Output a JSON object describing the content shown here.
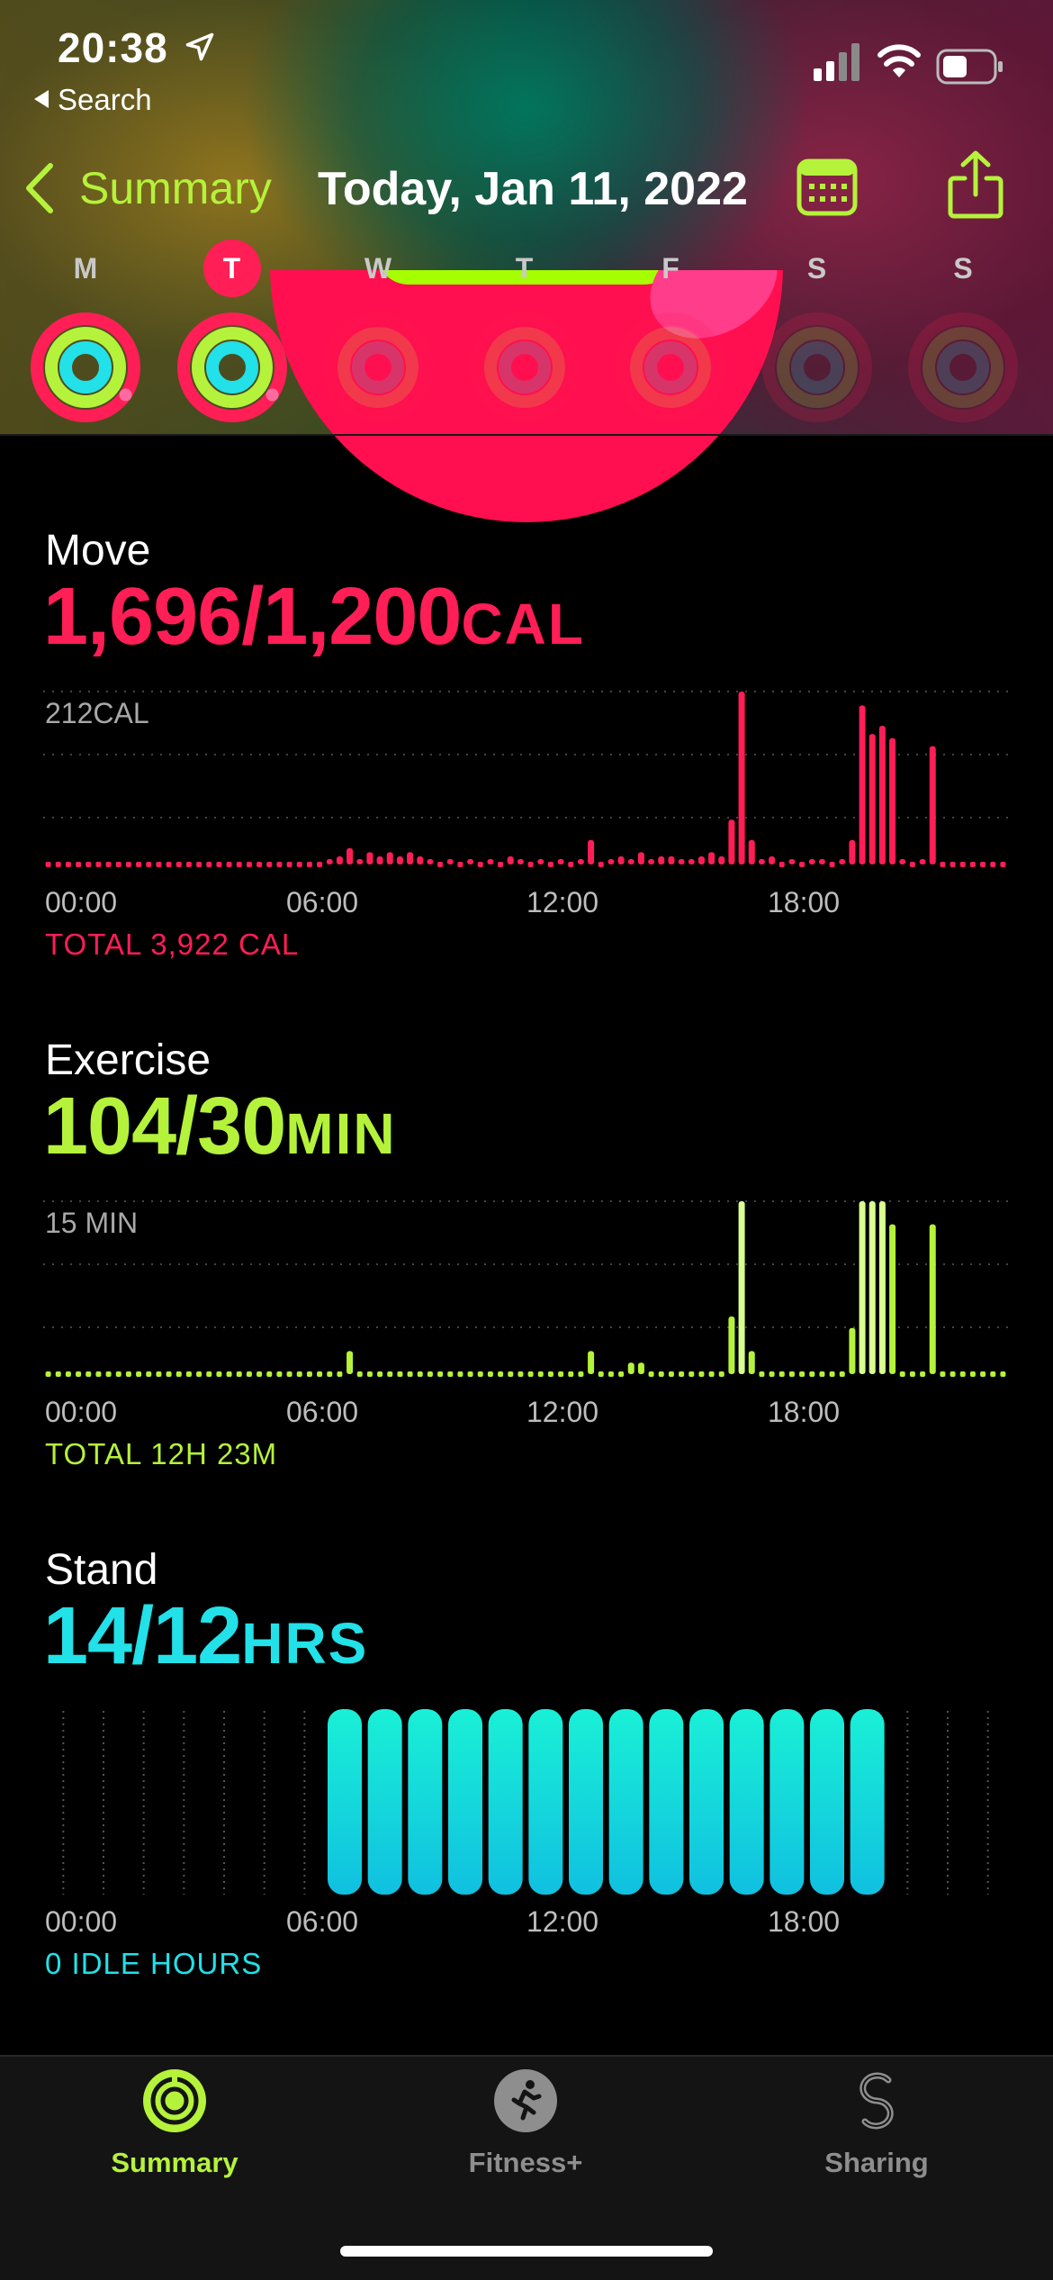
{
  "status_bar": {
    "time": "20:38",
    "back_app_label": "Search"
  },
  "nav": {
    "back_label": "Summary",
    "title": "Today, Jan 11, 2022",
    "accent_color": "#b5f23b"
  },
  "week": {
    "days": [
      "M",
      "T",
      "W",
      "T",
      "F",
      "S",
      "S"
    ],
    "selected_index": 1
  },
  "move": {
    "title": "Move",
    "value": "1,696/1,200",
    "unit": "CAL",
    "chart_label": "212CAL",
    "total": "TOTAL 3,922 CAL",
    "color": "#ff1e55"
  },
  "exercise": {
    "title": "Exercise",
    "value": "104/30",
    "unit": "MIN",
    "chart_label": "15 MIN",
    "total": "TOTAL 12H 23M",
    "color": "#b5f23b"
  },
  "stand": {
    "title": "Stand",
    "value": "14/12",
    "unit": "HRS",
    "total": "0 IDLE HOURS",
    "color": "#22e1e8"
  },
  "time_ticks": [
    "00:00",
    "06:00",
    "12:00",
    "18:00"
  ],
  "tabs": [
    {
      "label": "Summary",
      "icon": "activity-rings-icon",
      "active": true
    },
    {
      "label": "Fitness+",
      "icon": "running-figure-icon",
      "active": false
    },
    {
      "label": "Sharing",
      "icon": "sharing-s-icon",
      "active": false
    }
  ],
  "chart_data": [
    {
      "type": "bar",
      "name": "move",
      "x": [
        0,
        1,
        2,
        3,
        4,
        5,
        6,
        7,
        8,
        9,
        10,
        11,
        12,
        13,
        14,
        15,
        16,
        17,
        18,
        19,
        20,
        21,
        22,
        23,
        24,
        25,
        26,
        27,
        28,
        29,
        30,
        31,
        32,
        33,
        34,
        35,
        36,
        37,
        38,
        39,
        40,
        41,
        42,
        43,
        44,
        45,
        46,
        47,
        48,
        49,
        50,
        51,
        52,
        53,
        54,
        55,
        56,
        57,
        58,
        59,
        60,
        61,
        62,
        63,
        64,
        65,
        66,
        67,
        68,
        69,
        70,
        71,
        72,
        73,
        74,
        75,
        76,
        77,
        78,
        79,
        80,
        81,
        82,
        83,
        84,
        85,
        86,
        87,
        88,
        89,
        90,
        91,
        92,
        93,
        94,
        95
      ],
      "values": [
        0,
        0,
        0,
        0,
        0,
        0,
        0,
        0,
        0,
        0,
        0,
        0,
        0,
        0,
        0,
        0,
        0,
        0,
        0,
        0,
        0,
        0,
        0,
        0,
        0,
        0,
        0,
        0,
        5,
        10,
        20,
        5,
        15,
        10,
        15,
        10,
        15,
        10,
        5,
        0,
        5,
        0,
        5,
        0,
        5,
        0,
        10,
        5,
        0,
        5,
        0,
        5,
        0,
        5,
        30,
        0,
        5,
        10,
        5,
        15,
        5,
        10,
        10,
        5,
        5,
        10,
        15,
        10,
        55,
        212,
        30,
        5,
        10,
        0,
        5,
        0,
        5,
        5,
        0,
        5,
        30,
        195,
        160,
        170,
        155,
        5,
        0,
        5,
        145,
        0,
        0,
        0,
        0,
        0,
        0,
        0
      ],
      "x_ticks": [
        "00:00",
        "06:00",
        "12:00",
        "18:00"
      ],
      "gridline_label": "212CAL",
      "color": "#ff1e55"
    },
    {
      "type": "bar",
      "name": "exercise",
      "x": [
        0,
        1,
        2,
        3,
        4,
        5,
        6,
        7,
        8,
        9,
        10,
        11,
        12,
        13,
        14,
        15,
        16,
        17,
        18,
        19,
        20,
        21,
        22,
        23,
        24,
        25,
        26,
        27,
        28,
        29,
        30,
        31,
        32,
        33,
        34,
        35,
        36,
        37,
        38,
        39,
        40,
        41,
        42,
        43,
        44,
        45,
        46,
        47,
        48,
        49,
        50,
        51,
        52,
        53,
        54,
        55,
        56,
        57,
        58,
        59,
        60,
        61,
        62,
        63,
        64,
        65,
        66,
        67,
        68,
        69,
        70,
        71,
        72,
        73,
        74,
        75,
        76,
        77,
        78,
        79,
        80,
        81,
        82,
        83,
        84,
        85,
        86,
        87,
        88,
        89,
        90,
        91,
        92,
        93,
        94,
        95
      ],
      "values": [
        0,
        0,
        0,
        0,
        0,
        0,
        0,
        0,
        0,
        0,
        0,
        0,
        0,
        0,
        0,
        0,
        0,
        0,
        0,
        0,
        0,
        0,
        0,
        0,
        0,
        0,
        0,
        0,
        0,
        0,
        2,
        0,
        0,
        0,
        0,
        0,
        0,
        0,
        0,
        0,
        0,
        0,
        0,
        0,
        0,
        0,
        0,
        0,
        0,
        0,
        0,
        0,
        0,
        0,
        2,
        0,
        0,
        0,
        1,
        1,
        0,
        0,
        0,
        0,
        0,
        0,
        0,
        0,
        5,
        15,
        2,
        0,
        0,
        0,
        0,
        0,
        0,
        0,
        0,
        0,
        4,
        15,
        15,
        15,
        13,
        0,
        0,
        0,
        13,
        0,
        0,
        0,
        0,
        0,
        0,
        0
      ],
      "x_ticks": [
        "00:00",
        "06:00",
        "12:00",
        "18:00"
      ],
      "gridline_label": "15 MIN",
      "color": "#b5f23b"
    },
    {
      "type": "bar",
      "name": "stand",
      "categories": [
        "0",
        "1",
        "2",
        "3",
        "4",
        "5",
        "6",
        "7",
        "8",
        "9",
        "10",
        "11",
        "12",
        "13",
        "14",
        "15",
        "16",
        "17",
        "18",
        "19",
        "20",
        "21",
        "22",
        "23"
      ],
      "values": [
        0,
        0,
        0,
        0,
        0,
        0,
        0,
        1,
        1,
        1,
        1,
        1,
        1,
        1,
        1,
        1,
        1,
        1,
        1,
        1,
        1,
        0,
        0,
        0
      ],
      "x_ticks": [
        "00:00",
        "06:00",
        "12:00",
        "18:00"
      ],
      "color": "#22e1e8"
    }
  ]
}
